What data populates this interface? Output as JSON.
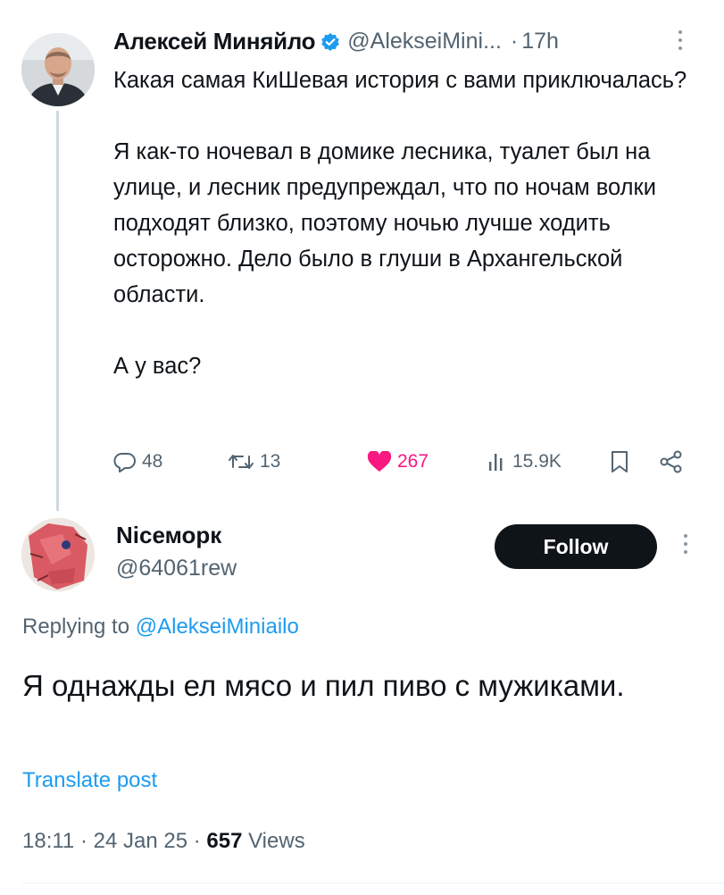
{
  "parent_post": {
    "author_name": "Алексей Миняйло",
    "handle": "@AlekseiMini...",
    "separator": "·",
    "time": "17h",
    "text": "Какая самая КиШевая история с вами приключалась?\n\nЯ как-то ночевал в домике лесника, туалет был на улице, и лесник предупреждал, что по ночам волки подходят близко, поэтому ночью лучше ходить осторожно. Дело было в глуши в Архангельской области.\n\nА у вас?",
    "stats": {
      "replies": "48",
      "reposts": "13",
      "likes": "267",
      "views": "15.9K"
    }
  },
  "reply_post": {
    "author_name": "Nісеморк",
    "handle": "@64061rew",
    "follow_label": "Follow",
    "replying_prefix": "Replying to",
    "replying_to": "@AlekseiMiniailo",
    "text": "Я однажды ел мясо и пил пиво с мужиками.",
    "translate_label": "Translate post",
    "time": "18:11",
    "date": "24 Jan 25",
    "views_count": "657",
    "views_label": "Views",
    "meta_separator": "·"
  },
  "colors": {
    "text_primary": "#0f1419",
    "text_secondary": "#536471",
    "accent_blue": "#1d9bf0",
    "like_pink": "#f91880",
    "button_dark": "#0f1419"
  },
  "icons": [
    "verified-badge-icon",
    "more-icon",
    "reply-icon",
    "repost-icon",
    "like-icon",
    "views-icon",
    "bookmark-icon",
    "share-icon"
  ]
}
